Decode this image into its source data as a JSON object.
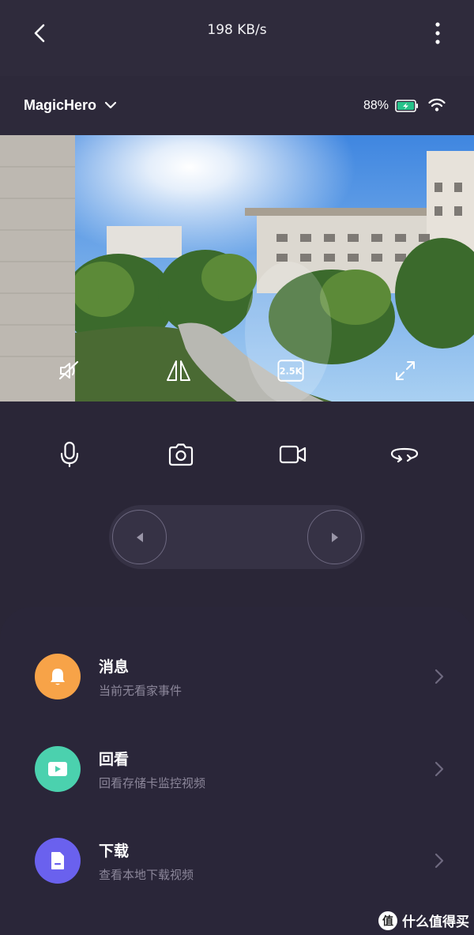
{
  "header": {
    "speed": "198 KB/s"
  },
  "device": {
    "name": "MagicHero",
    "battery": "88%"
  },
  "video_overlay": {
    "resolution": "2.5K"
  },
  "list": [
    {
      "title": "消息",
      "subtitle": "当前无看家事件",
      "color": "#f7a348",
      "icon": "bell-icon"
    },
    {
      "title": "回看",
      "subtitle": "回看存储卡监控视频",
      "color": "#4bd1ae",
      "icon": "play-icon"
    },
    {
      "title": "下载",
      "subtitle": "查看本地下载视频",
      "color": "#6a61ee",
      "icon": "file-icon"
    }
  ],
  "watermark": {
    "badge": "值",
    "text": "什么值得买"
  }
}
